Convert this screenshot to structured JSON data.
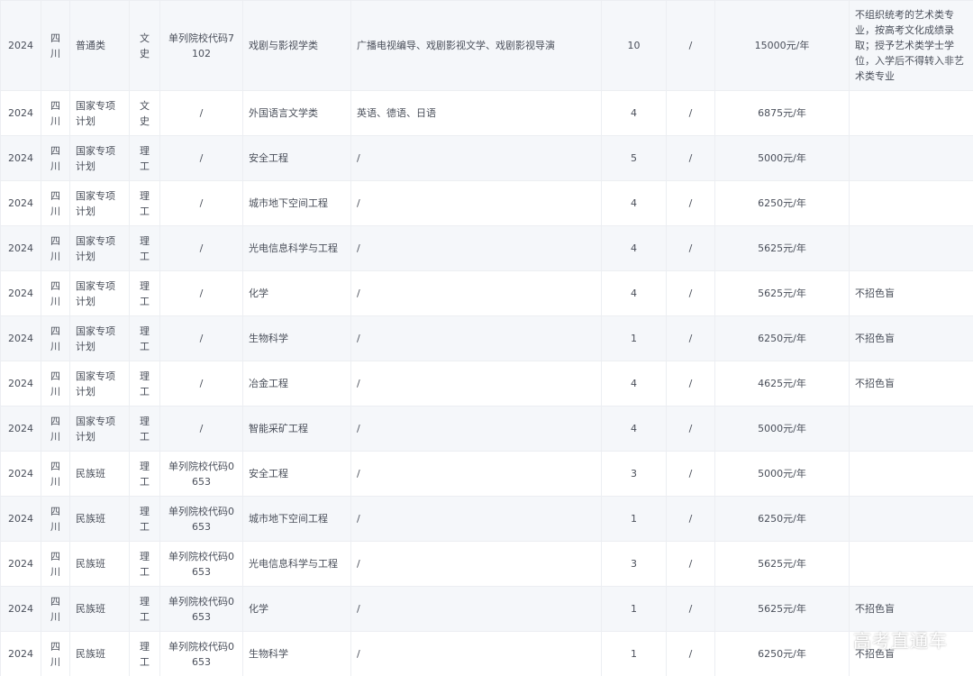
{
  "table": {
    "rows": [
      [
        "2024",
        "四川",
        "普通类",
        "文史",
        "单列院校代码7102",
        "戏剧与影视学类",
        "广播电视编导、戏剧影视文学、戏剧影视导演",
        "10",
        "/",
        "15000元/年",
        "不组织统考的艺术类专业，按高考文化成绩录取；授予艺术类学士学位，入学后不得转入非艺术类专业"
      ],
      [
        "2024",
        "四川",
        "国家专项计划",
        "文史",
        "/",
        "外国语言文学类",
        "英语、德语、日语",
        "4",
        "/",
        "6875元/年",
        ""
      ],
      [
        "2024",
        "四川",
        "国家专项计划",
        "理工",
        "/",
        "安全工程",
        "/",
        "5",
        "/",
        "5000元/年",
        ""
      ],
      [
        "2024",
        "四川",
        "国家专项计划",
        "理工",
        "/",
        "城市地下空间工程",
        "/",
        "4",
        "/",
        "6250元/年",
        ""
      ],
      [
        "2024",
        "四川",
        "国家专项计划",
        "理工",
        "/",
        "光电信息科学与工程",
        "/",
        "4",
        "/",
        "5625元/年",
        ""
      ],
      [
        "2024",
        "四川",
        "国家专项计划",
        "理工",
        "/",
        "化学",
        "/",
        "4",
        "/",
        "5625元/年",
        "不招色盲"
      ],
      [
        "2024",
        "四川",
        "国家专项计划",
        "理工",
        "/",
        "生物科学",
        "/",
        "1",
        "/",
        "6250元/年",
        "不招色盲"
      ],
      [
        "2024",
        "四川",
        "国家专项计划",
        "理工",
        "/",
        "冶金工程",
        "/",
        "4",
        "/",
        "4625元/年",
        "不招色盲"
      ],
      [
        "2024",
        "四川",
        "国家专项计划",
        "理工",
        "/",
        "智能采矿工程",
        "/",
        "4",
        "/",
        "5000元/年",
        ""
      ],
      [
        "2024",
        "四川",
        "民族班",
        "理工",
        "单列院校代码0653",
        "安全工程",
        "/",
        "3",
        "/",
        "5000元/年",
        ""
      ],
      [
        "2024",
        "四川",
        "民族班",
        "理工",
        "单列院校代码0653",
        "城市地下空间工程",
        "/",
        "1",
        "/",
        "6250元/年",
        ""
      ],
      [
        "2024",
        "四川",
        "民族班",
        "理工",
        "单列院校代码0653",
        "光电信息科学与工程",
        "/",
        "3",
        "/",
        "5625元/年",
        ""
      ],
      [
        "2024",
        "四川",
        "民族班",
        "理工",
        "单列院校代码0653",
        "化学",
        "/",
        "1",
        "/",
        "5625元/年",
        "不招色盲"
      ],
      [
        "2024",
        "四川",
        "民族班",
        "理工",
        "单列院校代码0653",
        "生物科学",
        "/",
        "1",
        "/",
        "6250元/年",
        "不招色盲"
      ]
    ]
  },
  "watermark": "高考直通车",
  "colors": {
    "row_alt": "#f5f7fa",
    "row": "#ffffff",
    "border": "#eceef2",
    "text": "#4a4f5a"
  }
}
